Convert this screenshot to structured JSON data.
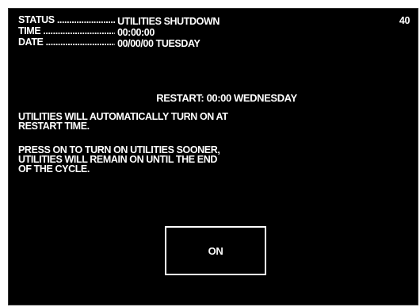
{
  "status_block": {
    "status_label": "STATUS ...................................",
    "status_value": "UTILITIES SHUTDOWN",
    "time_label": "TIME .......................................",
    "time_value": "00:00:00",
    "date_label": "DATE .......................................",
    "date_value": "00/00/00  TUESDAY"
  },
  "screen_number": "40",
  "restart": {
    "text": "RESTART:  00:00  WEDNESDAY"
  },
  "messages": {
    "auto_on": [
      "UTILITIES WILL AUTOMATICALLY TURN ON AT",
      "RESTART TIME."
    ],
    "press_on": [
      "PRESS ON TO TURN ON UTILITIES SOONER,",
      "UTILITIES WILL REMAIN ON UNTIL THE END",
      "OF THE CYCLE."
    ]
  },
  "buttons": {
    "on_label": "ON"
  },
  "colors": {
    "background": "#000000",
    "foreground": "#ffffff"
  }
}
